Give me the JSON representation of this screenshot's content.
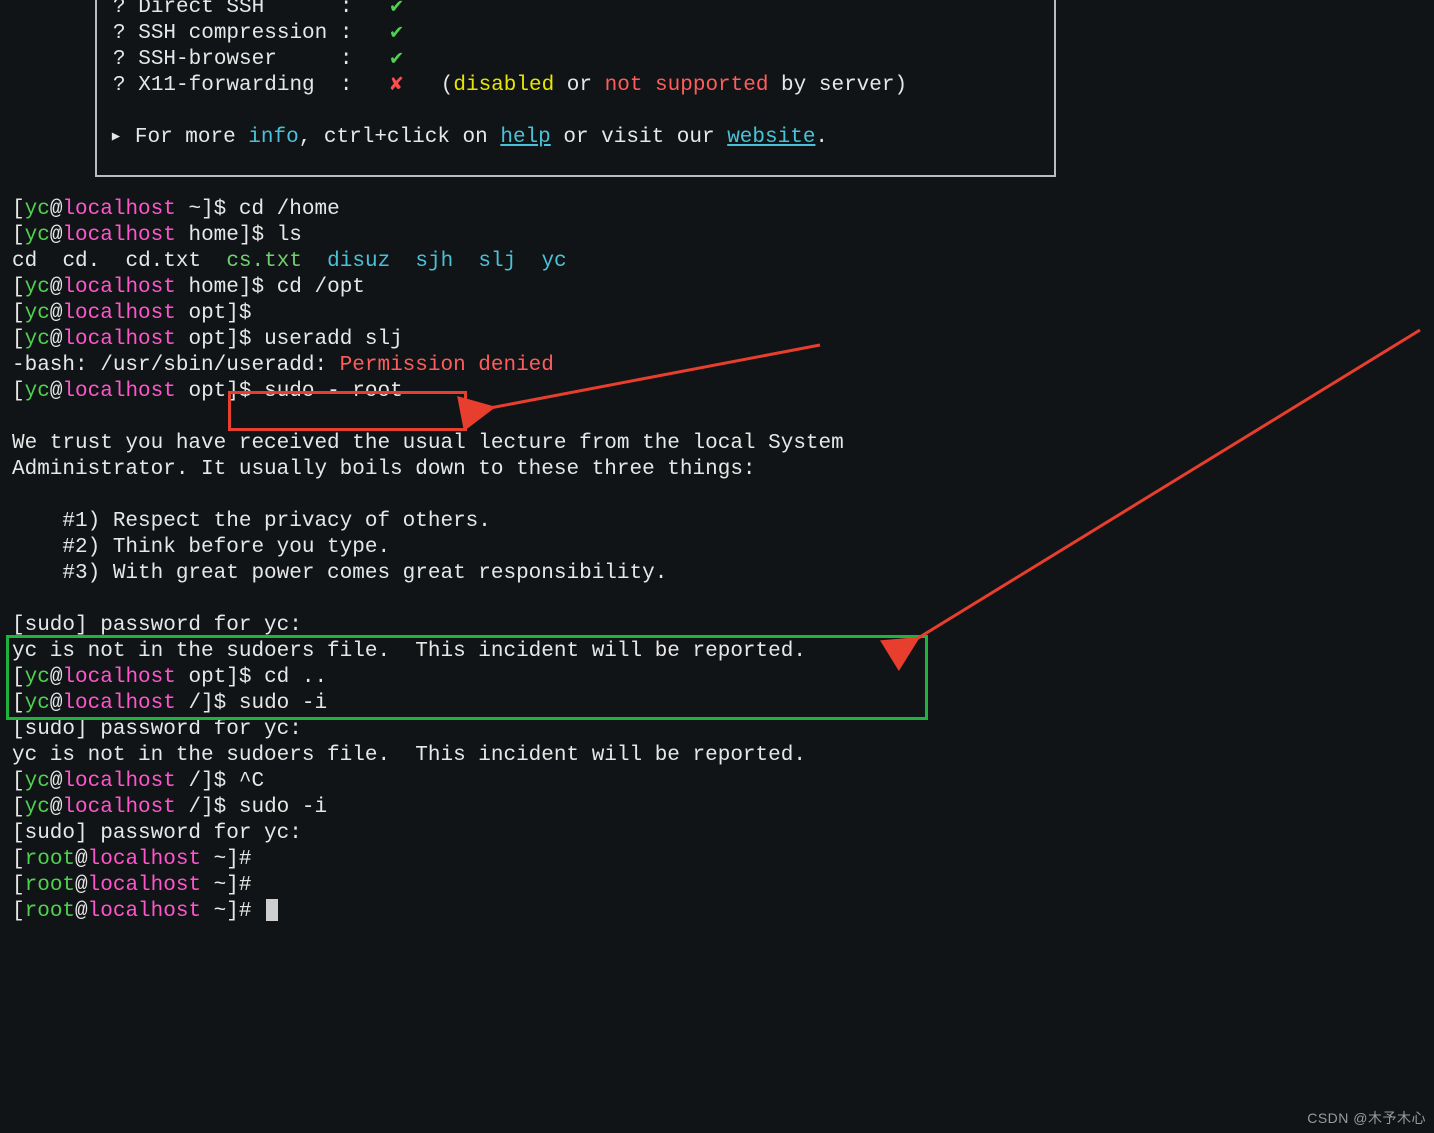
{
  "banner": {
    "rows": [
      {
        "label": "Direct SSH",
        "status": "ok"
      },
      {
        "label": "SSH compression",
        "status": "ok"
      },
      {
        "label": "SSH-browser",
        "status": "ok"
      },
      {
        "label": "X11-forwarding",
        "status": "no",
        "note_l": "(",
        "note_disabled": "disabled",
        "note_mid": " or ",
        "note_not": "not supported",
        "note_r": " by server)"
      }
    ],
    "info_prefix": "For more ",
    "info_word": "info",
    "info_mid": ", ctrl+click on ",
    "help": "help",
    "info_mid2": " or visit our ",
    "website": "website",
    "info_dot": "."
  },
  "ls": {
    "white": [
      "cd",
      "cd.",
      "cd.txt"
    ],
    "green": "cs.txt",
    "cyan": [
      "disuz",
      "sjh",
      "slj",
      "yc"
    ]
  },
  "prompts": {
    "u": "yc",
    "h": "localhost",
    "root": "root"
  },
  "lines": {
    "cd_home": "cd /home",
    "ls": "ls",
    "cd_opt": "cd /opt",
    "useradd": "useradd slj",
    "perm_err": "-bash: /usr/sbin/useradd: ",
    "perm_err2": "Permission denied",
    "sudo_root": " sudo - root",
    "trust1": "We trust you have received the usual lecture from the local System",
    "trust2": "Administrator. It usually boils down to these three things:",
    "rule1": "    #1) Respect the privacy of others.",
    "rule2": "    #2) Think before you type.",
    "rule3": "    #3) With great power comes great responsibility.",
    "pw": "[sudo] password for yc:",
    "notin": "yc is not in the sudoers file.  This incident will be reported.",
    "cddotdot": "cd ..",
    "sudoi": "sudo -i",
    "ctrlc": "^C"
  },
  "watermark": "CSDN @木予木心"
}
